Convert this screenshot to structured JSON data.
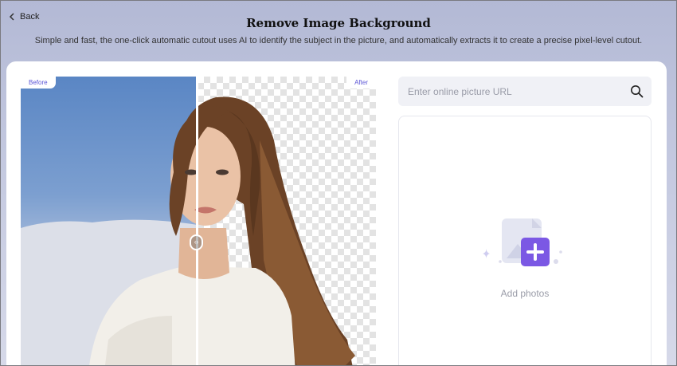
{
  "header": {
    "back_label": "Back",
    "title": "Remove Image Background",
    "subtitle": "Simple and fast, the one-click automatic cutout uses AI to identify the subject in the picture, and automatically extracts it to create a precise pixel-level cutout."
  },
  "compare": {
    "before_label": "Before",
    "after_label": "After"
  },
  "upload": {
    "url_placeholder": "Enter online picture URL",
    "url_value": "",
    "add_label": "Add photos"
  },
  "icons": {
    "back": "chevron-left-icon",
    "search": "search-icon",
    "add_photo": "add-photo-icon",
    "slider": "compare-slider-icon"
  },
  "colors": {
    "accent": "#6a4fd8",
    "tag_text": "#5b55d6"
  }
}
